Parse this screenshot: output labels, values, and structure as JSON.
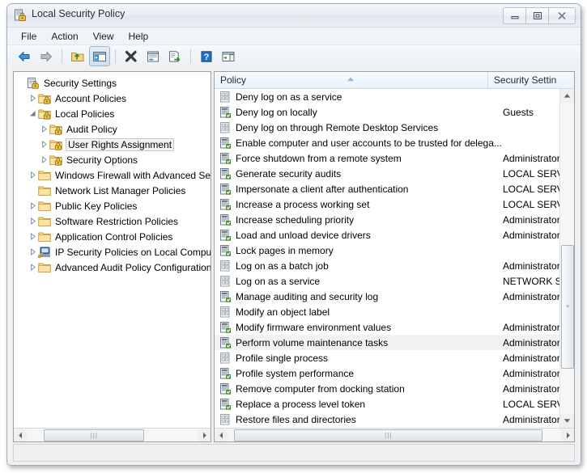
{
  "window": {
    "title": "Local Security Policy",
    "icon": "security-policy-icon",
    "controls": {
      "minimize": "Minimize",
      "maximize": "Maximize",
      "close": "Close"
    }
  },
  "menubar": {
    "items": [
      {
        "label": "File"
      },
      {
        "label": "Action"
      },
      {
        "label": "View"
      },
      {
        "label": "Help"
      }
    ]
  },
  "toolbar": {
    "buttons": [
      {
        "name": "back-button",
        "icon": "left-arrow-icon",
        "label": "Back"
      },
      {
        "name": "forward-button",
        "icon": "right-arrow-icon",
        "label": "Forward"
      },
      {
        "name": "up-one-level-button",
        "icon": "folder-up-icon",
        "label": "Up One Level"
      },
      {
        "name": "show-hide-tree-button",
        "icon": "console-tree-icon",
        "label": "Show/Hide Console Tree"
      },
      {
        "name": "delete-button",
        "icon": "delete-x-icon",
        "label": "Delete"
      },
      {
        "name": "properties-button",
        "icon": "properties-icon",
        "label": "Properties"
      },
      {
        "name": "export-list-button",
        "icon": "export-list-icon",
        "label": "Export List"
      },
      {
        "name": "help-button",
        "icon": "help-question-icon",
        "label": "Help"
      },
      {
        "name": "show-action-pane-button",
        "icon": "action-pane-icon",
        "label": "Show/Hide Action Pane"
      }
    ]
  },
  "tree": {
    "root": {
      "label": "Security Settings",
      "icon": "security-settings-icon"
    },
    "items": [
      {
        "label": "Security Settings",
        "icon": "security-settings-icon",
        "depth": 0,
        "expander": "none",
        "selected": false
      },
      {
        "label": "Account Policies",
        "icon": "policy-folder-icon",
        "depth": 1,
        "expander": "collapsed",
        "selected": false
      },
      {
        "label": "Local Policies",
        "icon": "policy-folder-icon",
        "depth": 1,
        "expander": "expanded",
        "selected": false
      },
      {
        "label": "Audit Policy",
        "icon": "policy-folder-icon",
        "depth": 2,
        "expander": "collapsed",
        "selected": false
      },
      {
        "label": "User Rights Assignment",
        "icon": "policy-folder-icon",
        "depth": 2,
        "expander": "collapsed",
        "selected": true
      },
      {
        "label": "Security Options",
        "icon": "policy-folder-icon",
        "depth": 2,
        "expander": "collapsed",
        "selected": false
      },
      {
        "label": "Windows Firewall with Advanced Secu",
        "icon": "folder-icon",
        "depth": 1,
        "expander": "collapsed",
        "selected": false
      },
      {
        "label": "Network List Manager Policies",
        "icon": "folder-icon",
        "depth": 1,
        "expander": "none",
        "selected": false
      },
      {
        "label": "Public Key Policies",
        "icon": "folder-icon",
        "depth": 1,
        "expander": "collapsed",
        "selected": false
      },
      {
        "label": "Software Restriction Policies",
        "icon": "folder-icon",
        "depth": 1,
        "expander": "collapsed",
        "selected": false
      },
      {
        "label": "Application Control Policies",
        "icon": "folder-icon",
        "depth": 1,
        "expander": "collapsed",
        "selected": false
      },
      {
        "label": "IP Security Policies on Local Compute",
        "icon": "ip-security-icon",
        "depth": 1,
        "expander": "collapsed",
        "selected": false
      },
      {
        "label": "Advanced Audit Policy Configuration",
        "icon": "folder-icon",
        "depth": 1,
        "expander": "collapsed",
        "selected": false
      }
    ],
    "hscroll": {
      "thumb_left_pct": 10,
      "thumb_width_pct": 58
    }
  },
  "list": {
    "columns": [
      {
        "key": "policy",
        "label": "Policy",
        "sort": "ascending"
      },
      {
        "key": "setting",
        "label": "Security Settin",
        "sort": "none"
      }
    ],
    "rows": [
      {
        "policy": "Deny log on as a service",
        "setting": "",
        "icon": "policy-unset-icon",
        "selected": false
      },
      {
        "policy": "Deny log on locally",
        "setting": "Guests",
        "icon": "policy-set-icon",
        "selected": false
      },
      {
        "policy": "Deny log on through Remote Desktop Services",
        "setting": "",
        "icon": "policy-unset-icon",
        "selected": false
      },
      {
        "policy": "Enable computer and user accounts to be trusted for delega...",
        "setting": "",
        "icon": "policy-set-icon",
        "selected": false
      },
      {
        "policy": "Force shutdown from a remote system",
        "setting": "Administrator",
        "icon": "policy-set-icon",
        "selected": false
      },
      {
        "policy": "Generate security audits",
        "setting": "LOCAL SERVIC",
        "icon": "policy-set-icon",
        "selected": false
      },
      {
        "policy": "Impersonate a client after authentication",
        "setting": "LOCAL SERVIC",
        "icon": "policy-set-icon",
        "selected": false
      },
      {
        "policy": "Increase a process working set",
        "setting": "LOCAL SERVIC",
        "icon": "policy-set-icon",
        "selected": false
      },
      {
        "policy": "Increase scheduling priority",
        "setting": "Administrator",
        "icon": "policy-set-icon",
        "selected": false
      },
      {
        "policy": "Load and unload device drivers",
        "setting": "Administrator",
        "icon": "policy-set-icon",
        "selected": false
      },
      {
        "policy": "Lock pages in memory",
        "setting": "",
        "icon": "policy-set-icon",
        "selected": false
      },
      {
        "policy": "Log on as a batch job",
        "setting": "Administrator",
        "icon": "policy-unset-icon",
        "selected": false
      },
      {
        "policy": "Log on as a service",
        "setting": "NETWORK SE",
        "icon": "policy-unset-icon",
        "selected": false
      },
      {
        "policy": "Manage auditing and security log",
        "setting": "Administrator",
        "icon": "policy-set-icon",
        "selected": false
      },
      {
        "policy": "Modify an object label",
        "setting": "",
        "icon": "policy-unset-icon",
        "selected": false
      },
      {
        "policy": "Modify firmware environment values",
        "setting": "Administrator",
        "icon": "policy-set-icon",
        "selected": false
      },
      {
        "policy": "Perform volume maintenance tasks",
        "setting": "Administrator",
        "icon": "policy-set-icon",
        "selected": true
      },
      {
        "policy": "Profile single process",
        "setting": "Administrator",
        "icon": "policy-unset-icon",
        "selected": false
      },
      {
        "policy": "Profile system performance",
        "setting": "Administrator",
        "icon": "policy-set-icon",
        "selected": false
      },
      {
        "policy": "Remove computer from docking station",
        "setting": "Administrator",
        "icon": "policy-set-icon",
        "selected": false
      },
      {
        "policy": "Replace a process level token",
        "setting": "LOCAL SERVIC",
        "icon": "policy-set-icon",
        "selected": false
      },
      {
        "policy": "Restore files and directories",
        "setting": "Administrator",
        "icon": "policy-unset-icon",
        "selected": false
      }
    ],
    "vscroll": {
      "thumb_top_pct": 42,
      "thumb_height_pct": 36
    },
    "hscroll": {
      "thumb_left_pct": 2,
      "thumb_width_pct": 92
    }
  },
  "colors": {
    "selection_row": "#f2f2f2",
    "header_gradient_top": "#f7fbfe",
    "header_gradient_bottom": "#eaf3fb",
    "folder_yellow": "#fcd98a",
    "lock_gold": "#d8a21f",
    "accent_blue": "#2f6fb5",
    "green_check": "#5faa34",
    "window_border": "#9badc4"
  }
}
